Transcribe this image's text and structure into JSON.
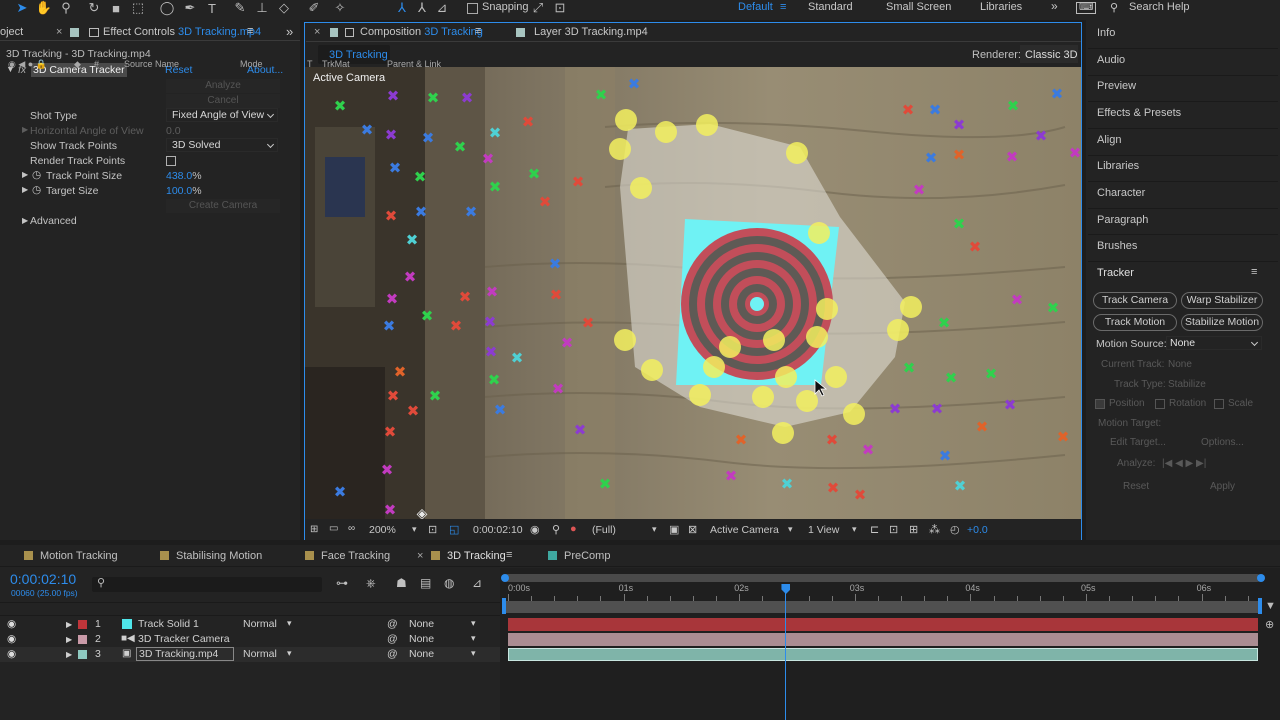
{
  "toolbar": {
    "snapping_label": "Snapping",
    "workspaces": [
      {
        "label": "Default"
      },
      {
        "label": "Standard"
      },
      {
        "label": "Small Screen"
      },
      {
        "label": "Libraries"
      }
    ],
    "search_label": "Search Help"
  },
  "left_panel": {
    "tab_project": "oject",
    "tab_effect_controls_prefix": "Effect Controls",
    "tab_effect_controls_file": "3D Tracking.mp4",
    "breadcrumb": "3D Tracking - 3D Tracking.mp4",
    "effect_name": "3D Camera Tracker",
    "reset_label": "Reset",
    "about_label": "About...",
    "analyze_label": "Analyze",
    "cancel_label": "Cancel",
    "shot_type_label": "Shot Type",
    "shot_type_value": "Fixed Angle of View",
    "horizontal_angle_label": "Horizontal Angle of View",
    "horizontal_angle_value": "0.0",
    "show_track_points_label": "Show Track Points",
    "show_track_points_value": "3D Solved",
    "render_track_points_label": "Render Track Points",
    "track_point_size_label": "Track Point Size",
    "track_point_size_value": "438.0",
    "target_size_label": "Target Size",
    "target_size_value": "100.0",
    "percent": "%",
    "create_camera_label": "Create Camera",
    "advanced_label": "Advanced"
  },
  "composition": {
    "tab_composition_prefix": "Composition",
    "tab_composition_name": "3D Tracking",
    "tab_layer": "Layer 3D Tracking.mp4",
    "sub_tab": "3D Tracking",
    "renderer_label": "Renderer:",
    "renderer_value": "Classic 3D",
    "viewer_label": "Active Camera",
    "zoom": "200%",
    "timecode": "0:00:02:10",
    "resolution": "(Full)",
    "camera_view": "Active Camera",
    "views": "1 View",
    "exposure": "+0.0"
  },
  "right_panel": {
    "items": [
      "Info",
      "Audio",
      "Preview",
      "Effects & Presets",
      "Align",
      "Libraries",
      "Character",
      "Paragraph",
      "Brushes"
    ],
    "tracker_title": "Tracker",
    "buttons": [
      "Track Camera",
      "Warp Stabilizer",
      "Track Motion",
      "Stabilize Motion"
    ],
    "motion_source_label": "Motion Source:",
    "motion_source_value": "None",
    "current_track_label": "Current Track:",
    "current_track_value": "None",
    "track_type_label": "Track Type:",
    "track_type_value": "Stabilize",
    "position_label": "Position",
    "rotation_label": "Rotation",
    "scale_label": "Scale",
    "motion_target_label": "Motion Target:",
    "edit_target_label": "Edit Target...",
    "options_label": "Options...",
    "analyze_label": "Analyze:",
    "reset_label": "Reset",
    "apply_label": "Apply"
  },
  "timeline": {
    "tabs": [
      {
        "label": "Motion Tracking",
        "color": "#a8904d"
      },
      {
        "label": "Stabilising Motion",
        "color": "#a8904d"
      },
      {
        "label": "Face Tracking",
        "color": "#a8904d"
      },
      {
        "label": "3D Tracking",
        "color": "#a8904d"
      },
      {
        "label": "PreComp",
        "color": "#3fa8a0"
      }
    ],
    "timecode": "0:00:02:10",
    "frame_info": "00060 (25.00 fps)",
    "headers": {
      "source_name": "Source Name",
      "mode": "Mode",
      "t": "T",
      "trkmat": "TrkMat",
      "parent": "Parent & Link"
    },
    "ruler_labels": [
      "0:00s",
      "01s",
      "02s",
      "03s",
      "04s",
      "05s",
      "06s"
    ],
    "playhead_seconds": 2.4,
    "layers": [
      {
        "index": "1",
        "name": "Track Solid 1",
        "mode": "Normal",
        "parent": "None",
        "label_color": "#c0353a",
        "bar_color": "#a8363a"
      },
      {
        "index": "2",
        "name": "3D Tracker Camera",
        "mode": "",
        "parent": "None",
        "label_color": "#c99aa8",
        "bar_color": "#ab8c92"
      },
      {
        "index": "3",
        "name": "3D Tracking.mp4",
        "mode": "Normal",
        "parent": "None",
        "label_color": "#8ec9c0",
        "bar_color": "#7fb4a9"
      }
    ]
  },
  "colors": {
    "accent": "#2d8ceb",
    "panel": "#232323",
    "background": "#1d1d1d"
  }
}
